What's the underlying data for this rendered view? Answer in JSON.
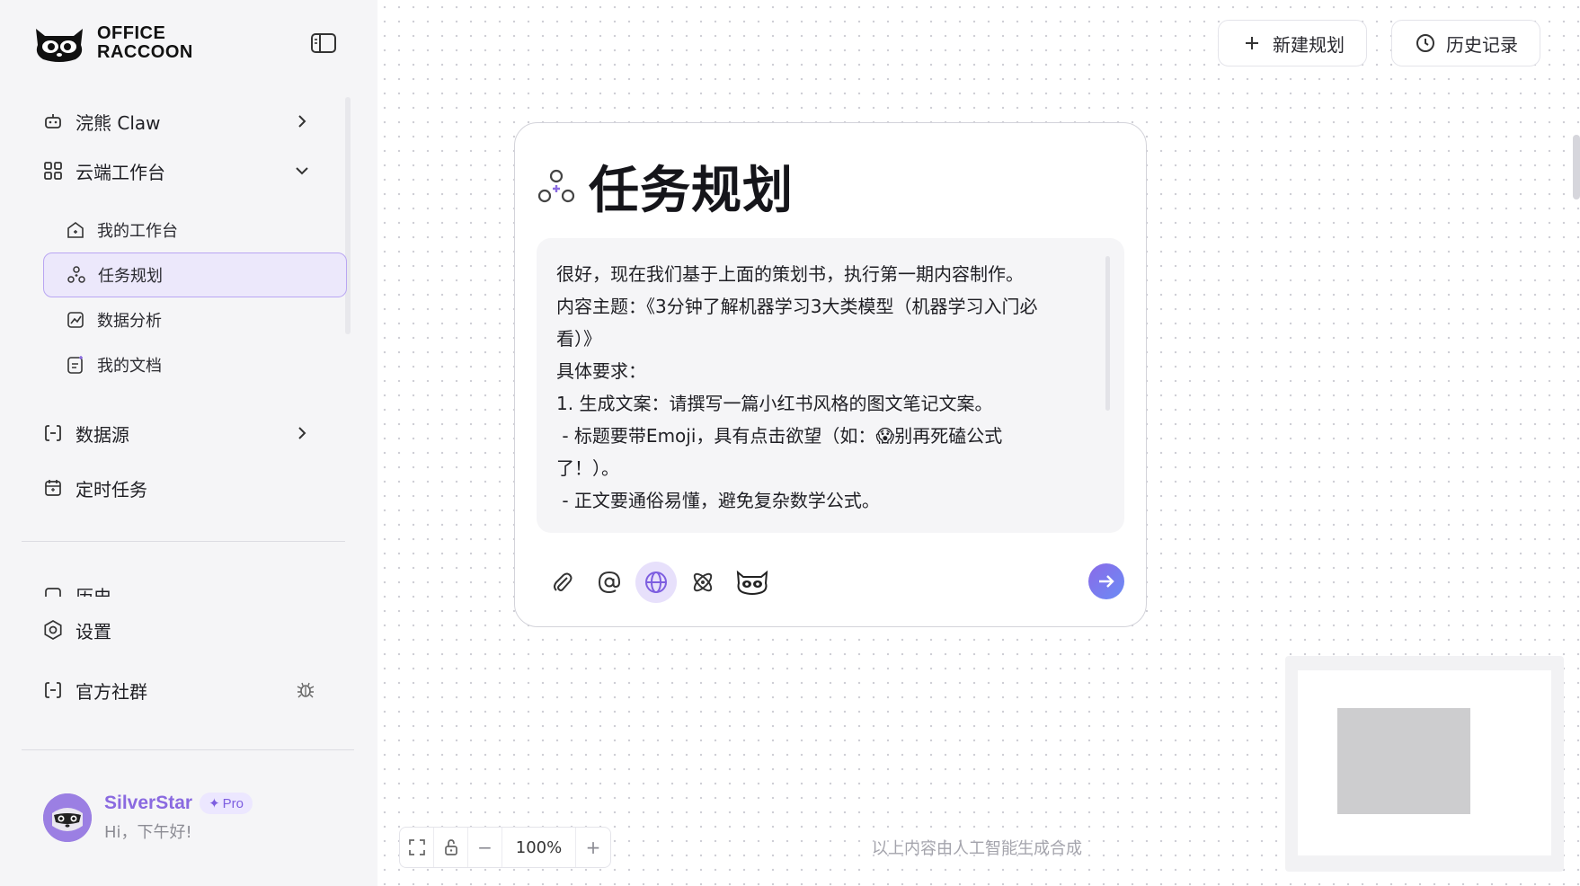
{
  "app": {
    "logo_line1": "OFFICE",
    "logo_line2": "RACCOON"
  },
  "sidebar": {
    "collapse_icon": "sidebar-toggle-icon",
    "items": [
      {
        "label": "浣熊 Claw",
        "icon": "robot-icon",
        "expanded": false
      },
      {
        "label": "云端工作台",
        "icon": "grid-icon",
        "expanded": true
      }
    ],
    "sub_items": [
      {
        "label": "我的工作台",
        "icon": "home-icon"
      },
      {
        "label": "任务规划",
        "icon": "task-plan-icon",
        "active": true
      },
      {
        "label": "数据分析",
        "icon": "chart-icon"
      },
      {
        "label": "我的文档",
        "icon": "document-icon"
      }
    ],
    "datasource": {
      "label": "数据源",
      "icon": "datasource-icon"
    },
    "scheduled": {
      "label": "定时任务",
      "icon": "calendar-icon"
    },
    "history": {
      "label": "历史",
      "icon": "history-icon"
    },
    "settings": {
      "label": "设置",
      "icon": "settings-icon"
    },
    "community": {
      "label": "官方社群",
      "icon": "community-icon",
      "extra_icon": "bug-icon"
    }
  },
  "user": {
    "name": "SilverStar",
    "badge": "Pro",
    "greeting": "Hi，下午好!"
  },
  "header": {
    "new_plan": {
      "label": "新建规划",
      "icon": "plus-icon"
    },
    "history": {
      "label": "历史记录",
      "icon": "clock-icon"
    }
  },
  "card": {
    "title": "任务规划",
    "prompt_lines": [
      "很好，现在我们基于上面的策划书，执行第一期内容制作。",
      "内容主题：《3分钟了解机器学习3大类模型（机器学习入门必",
      "看）》",
      "具体要求：",
      "1. 生成文案：请撰写一篇小红书风格的图文笔记文案。",
      " - 标题要带Emoji，具有点击欲望（如：😱别再死磕公式",
      "了！）。",
      " - 正文要通俗易懂，避免复杂数学公式。"
    ],
    "tools": [
      "attach-icon",
      "mention-icon",
      "globe-icon",
      "atom-icon",
      "raccoon-icon"
    ],
    "send_icon": "send-arrow-icon"
  },
  "zoom": {
    "level": "100%",
    "minus": "−",
    "plus": "+"
  },
  "disclaimer": "以上内容由人工智能生成合成",
  "colors": {
    "accent": "#8a6ae0",
    "active_bg": "#ece8fb",
    "active_border": "#b9a6f2"
  }
}
